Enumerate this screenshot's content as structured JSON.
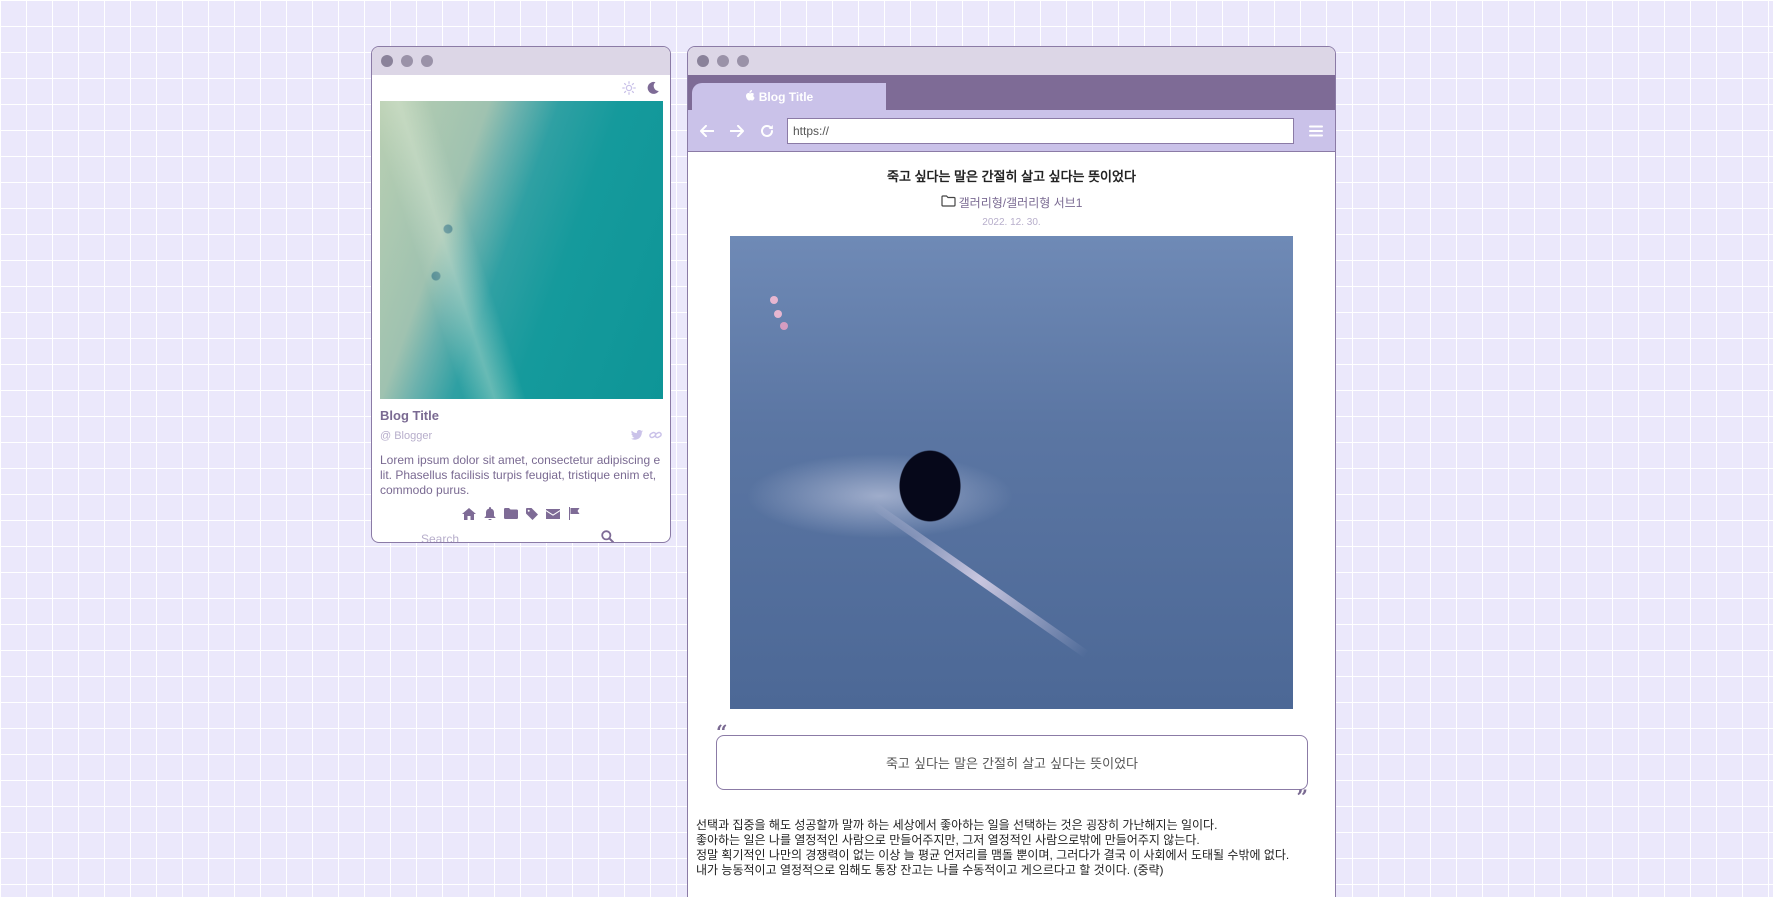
{
  "profile": {
    "blog_title": "Blog Title",
    "blogger": "@ Blogger",
    "description": "Lorem ipsum dolor sit amet, consectetur adipiscing elit. Phasellus facilisis turpis feugiat, tristique enim et, commodo purus.",
    "search_placeholder": "Search",
    "nav_icons": [
      "home-icon",
      "bell-icon",
      "folder-icon",
      "tag-icon",
      "envelope-icon",
      "flag-icon"
    ],
    "social_icons": [
      "twitter-icon",
      "link-icon"
    ],
    "theme_icons": [
      "sun-icon",
      "moon-icon"
    ]
  },
  "browser": {
    "tab_label": "Blog Title",
    "url": "https://",
    "post": {
      "title": "죽고 싶다는 말은 간절히 살고 싶다는 뜻이었다",
      "category": "갤러리형/갤러리형 서브1",
      "date": "2022. 12. 30.",
      "quote": "죽고 싶다는 말은 간절히 살고 싶다는 뜻이었다",
      "paragraphs": [
        "선택과 집중을 해도 성공할까 말까 하는 세상에서 좋아하는 일을 선택하는 것은 굉장히 가난해지는 일이다.",
        "좋아하는 일은 나를 열정적인 사람으로 만들어주지만, 그저 열정적인 사람으로밖에 만들어주지 않는다.",
        "정말 획기적인 나만의 경쟁력이 없는 이상 늘 평균 언저리를 맴돌 뿐이며, 그러다가 결국 이 사회에서 도태될 수밖에 없다.",
        "내가 능동적이고 열정적으로 임해도 통장 잔고는 나를 수동적이고 게으르다고 할 것이다. (중략)"
      ]
    }
  },
  "colors": {
    "background": "#ebe8fb",
    "accent": "#7e6b96",
    "tab": "#cac2e9",
    "muted": "#b7aecb"
  }
}
